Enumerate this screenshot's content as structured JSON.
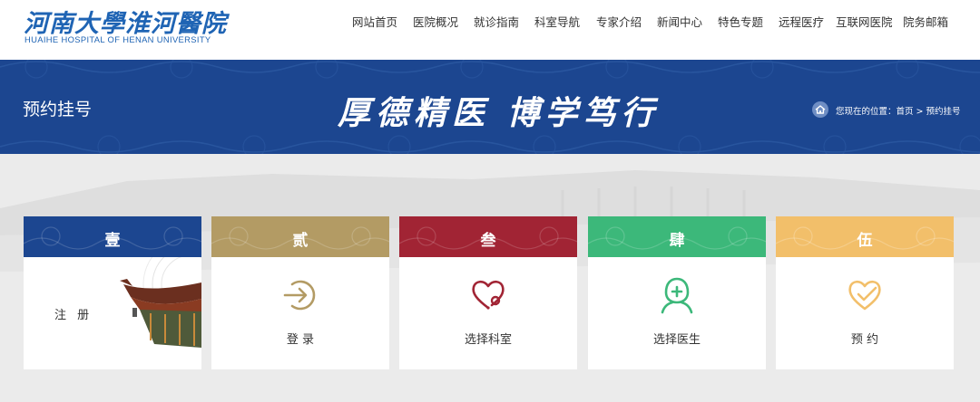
{
  "header": {
    "logo_cn": "河南大學淮河醫院",
    "logo_en": "HUAIHE HOSPITAL OF HENAN UNIVERSITY",
    "nav": [
      {
        "label": "网站首页"
      },
      {
        "label": "医院概况"
      },
      {
        "label": "就诊指南"
      },
      {
        "label": "科室导航"
      },
      {
        "label": "专家介绍"
      },
      {
        "label": "新闻中心"
      },
      {
        "label": "特色专题"
      },
      {
        "label": "远程医疗"
      },
      {
        "label": "互联网医院"
      },
      {
        "label": "院务邮箱"
      }
    ]
  },
  "banner": {
    "title": "预约挂号",
    "slogan": "厚德精医  博学笃行",
    "breadcrumb": "您现在的位置：首页 > 预约挂号",
    "color": "#1c4690"
  },
  "steps": [
    {
      "num": "壹",
      "label": "注 册",
      "color": "#1c4690",
      "icon": "pagoda-roof-illustration"
    },
    {
      "num": "贰",
      "label": "登 录",
      "color": "#b39b64",
      "icon": "login-arrow-icon"
    },
    {
      "num": "叁",
      "label": "选择科室",
      "color": "#a12434",
      "icon": "stethoscope-heart-icon"
    },
    {
      "num": "肆",
      "label": "选择医生",
      "color": "#3cb87a",
      "icon": "doctor-icon"
    },
    {
      "num": "伍",
      "label": "预 约",
      "color": "#f2bf6a",
      "icon": "heart-check-icon"
    }
  ]
}
